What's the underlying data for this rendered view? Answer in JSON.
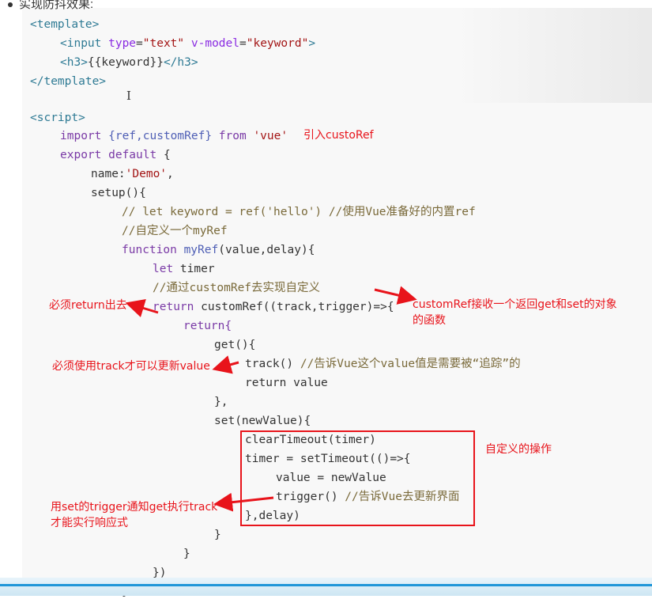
{
  "header": {
    "bullet_text": "实现防抖效果:"
  },
  "code": {
    "l1": "<template>",
    "l2a": "<input ",
    "l2b": "type",
    "l2c": "=",
    "l2d": "\"text\"",
    "l2e": " ",
    "l2f": "v-model",
    "l2g": "=",
    "l2h": "\"keyword\"",
    "l2i": ">",
    "l3a": "<h3>",
    "l3b": "{{keyword}}",
    "l3c": "</h3>",
    "l4": "</template>",
    "l5": "<script>",
    "l6a": "import ",
    "l6b": "{ref,customRef}",
    "l6c": " from ",
    "l6d": "'vue'",
    "l7a": "export default ",
    "l7b": "{",
    "l8a": "name:",
    "l8b": "'Demo'",
    "l8c": ",",
    "l9": "setup(){",
    "l10": "// let keyword = ref('hello') //使用Vue准备好的内置ref",
    "l11": "//自定义一个myRef",
    "l12a": "function ",
    "l12b": "myRef",
    "l12c": "(value,delay){",
    "l13a": "let ",
    "l13b": "timer",
    "l14": "//通过customRef去实现自定义",
    "l15a": "return ",
    "l15b": "customRef",
    "l15c": "((track,trigger)=>{",
    "l16": "return{",
    "l17": "get(){",
    "l18a": "track()",
    "l18b": " //告诉Vue这个value值是需要被“追踪”的",
    "l19": "return value",
    "l20": "},",
    "l21": "set(newValue){",
    "l22": "clearTimeout(timer)",
    "l23": "timer = setTimeout(()=>{",
    "l24": "value = newValue",
    "l25a": "trigger()",
    "l25b": " //告诉Vue去更新界面",
    "l26": "},delay)",
    "l27": "}",
    "l28": "}",
    "l29": "})",
    "l30": "}"
  },
  "annotations": {
    "import_note": "引入custoRef",
    "return_note": "必须return出去",
    "customref_note_1": "customRef接收一个返回get和set的对象",
    "customref_note_2": "的函数",
    "track_note": "必须使用track才可以更新value",
    "custom_op_note": "自定义的操作",
    "trigger_note_1": "用set的trigger通知get执行track",
    "trigger_note_2": "才能实行响应式"
  },
  "colors": {
    "annotation_red": "#e8141b",
    "taskbar_blue": "#2196d8"
  }
}
